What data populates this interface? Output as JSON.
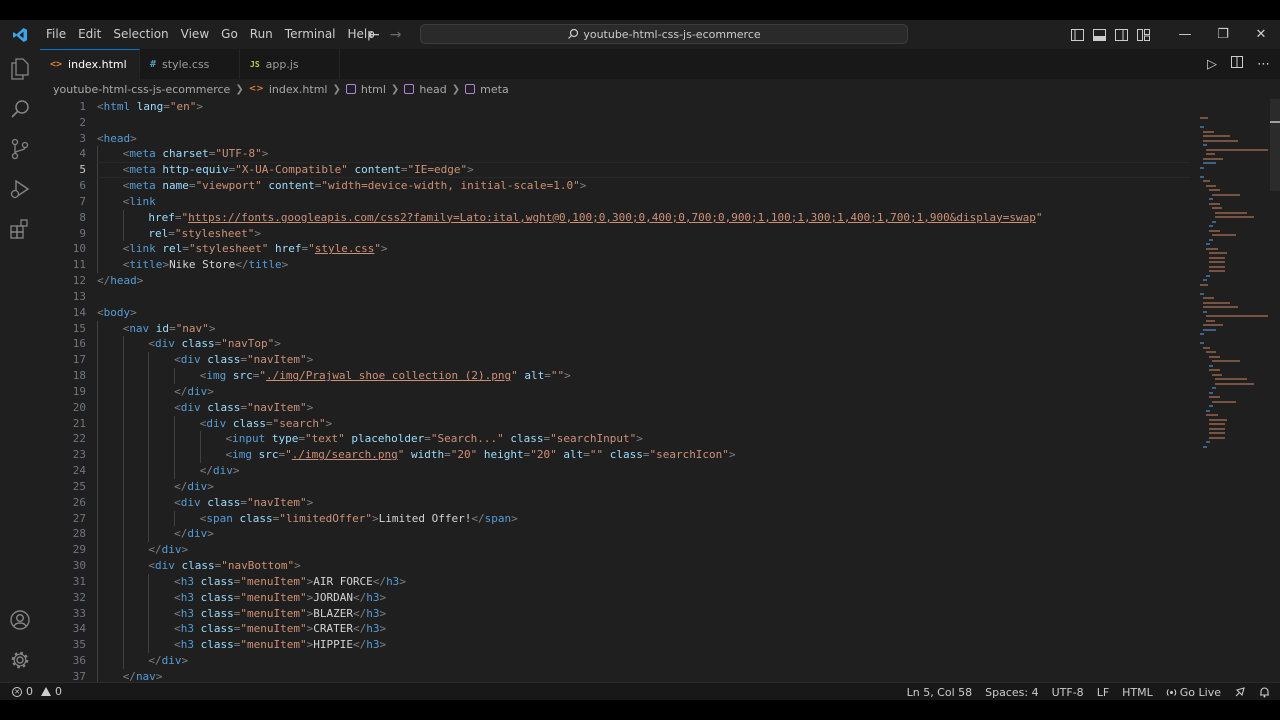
{
  "colors": {
    "accent": "#0078d4",
    "tag": "#569cd6",
    "attribute": "#9cdcfe",
    "string": "#ce9178",
    "text": "#d4d4d4",
    "punctuation": "#808080"
  },
  "titlebar": {
    "app_icon": "vscode-logo-icon",
    "menu": [
      "File",
      "Edit",
      "Selection",
      "View",
      "Go",
      "Run",
      "Terminal",
      "Help"
    ],
    "search_text": "youtube-html-css-js-ecommerce",
    "window_buttons": [
      "minimize",
      "maximize",
      "close"
    ]
  },
  "activitybar": {
    "top": [
      "explorer-icon",
      "search-icon",
      "source-control-icon",
      "run-debug-icon",
      "extensions-icon"
    ],
    "bottom": [
      "accounts-icon",
      "settings-gear-icon"
    ]
  },
  "tabs": [
    {
      "label": "index.html",
      "icon": "<>",
      "active": true
    },
    {
      "label": "style.css",
      "icon": "#",
      "active": false
    },
    {
      "label": "app.js",
      "icon": "JS",
      "active": false
    }
  ],
  "breadcrumb": [
    "youtube-html-css-js-ecommerce",
    "index.html",
    "html",
    "head",
    "meta"
  ],
  "editor": {
    "current_line": 5,
    "lines": [
      {
        "n": 1,
        "indent": 0,
        "tokens": [
          [
            "p",
            "<"
          ],
          [
            "t",
            "html"
          ],
          [
            "a",
            " lang"
          ],
          [
            "p",
            "="
          ],
          [
            "s",
            "\"en\""
          ],
          [
            "p",
            ">"
          ]
        ]
      },
      {
        "n": 2,
        "indent": 0,
        "tokens": []
      },
      {
        "n": 3,
        "indent": 0,
        "tokens": [
          [
            "p",
            "<"
          ],
          [
            "t",
            "head"
          ],
          [
            "p",
            ">"
          ]
        ]
      },
      {
        "n": 4,
        "indent": 1,
        "tokens": [
          [
            "p",
            "<"
          ],
          [
            "t",
            "meta"
          ],
          [
            "a",
            " charset"
          ],
          [
            "p",
            "="
          ],
          [
            "s",
            "\"UTF-8\""
          ],
          [
            "p",
            ">"
          ]
        ]
      },
      {
        "n": 5,
        "indent": 1,
        "tokens": [
          [
            "p",
            "<"
          ],
          [
            "t",
            "meta"
          ],
          [
            "a",
            " http-equiv"
          ],
          [
            "p",
            "="
          ],
          [
            "s",
            "\"X-UA-Compatible\""
          ],
          [
            "a",
            " content"
          ],
          [
            "p",
            "="
          ],
          [
            "s",
            "\"IE=edge\""
          ],
          [
            "p",
            ">"
          ]
        ]
      },
      {
        "n": 6,
        "indent": 1,
        "tokens": [
          [
            "p",
            "<"
          ],
          [
            "t",
            "meta"
          ],
          [
            "a",
            " name"
          ],
          [
            "p",
            "="
          ],
          [
            "s",
            "\"viewport\""
          ],
          [
            "a",
            " content"
          ],
          [
            "p",
            "="
          ],
          [
            "s",
            "\"width=device-width, initial-scale=1.0\""
          ],
          [
            "p",
            ">"
          ]
        ]
      },
      {
        "n": 7,
        "indent": 1,
        "tokens": [
          [
            "p",
            "<"
          ],
          [
            "t",
            "link"
          ]
        ]
      },
      {
        "n": 8,
        "indent": 2,
        "tokens": [
          [
            "a",
            "href"
          ],
          [
            "p",
            "="
          ],
          [
            "s",
            "\""
          ],
          [
            "u",
            "https://fonts.googleapis.com/css2?family=Lato:ital,wght@0,100;0,300;0,400;0,700;0,900;1,100;1,300;1,400;1,700;1,900&display=swap"
          ],
          [
            "s",
            "\""
          ]
        ]
      },
      {
        "n": 9,
        "indent": 2,
        "tokens": [
          [
            "a",
            "rel"
          ],
          [
            "p",
            "="
          ],
          [
            "s",
            "\"stylesheet\""
          ],
          [
            "p",
            ">"
          ]
        ]
      },
      {
        "n": 10,
        "indent": 1,
        "tokens": [
          [
            "p",
            "<"
          ],
          [
            "t",
            "link"
          ],
          [
            "a",
            " rel"
          ],
          [
            "p",
            "="
          ],
          [
            "s",
            "\"stylesheet\""
          ],
          [
            "a",
            " href"
          ],
          [
            "p",
            "="
          ],
          [
            "s",
            "\""
          ],
          [
            "u",
            "style.css"
          ],
          [
            "s",
            "\""
          ],
          [
            "p",
            ">"
          ]
        ]
      },
      {
        "n": 11,
        "indent": 1,
        "tokens": [
          [
            "p",
            "<"
          ],
          [
            "t",
            "title"
          ],
          [
            "p",
            ">"
          ],
          [
            "x",
            "Nike Store"
          ],
          [
            "p",
            "</"
          ],
          [
            "t",
            "title"
          ],
          [
            "p",
            ">"
          ]
        ]
      },
      {
        "n": 12,
        "indent": 0,
        "tokens": [
          [
            "p",
            "</"
          ],
          [
            "t",
            "head"
          ],
          [
            "p",
            ">"
          ]
        ]
      },
      {
        "n": 13,
        "indent": 0,
        "tokens": []
      },
      {
        "n": 14,
        "indent": 0,
        "tokens": [
          [
            "p",
            "<"
          ],
          [
            "t",
            "body"
          ],
          [
            "p",
            ">"
          ]
        ]
      },
      {
        "n": 15,
        "indent": 1,
        "tokens": [
          [
            "p",
            "<"
          ],
          [
            "t",
            "nav"
          ],
          [
            "a",
            " id"
          ],
          [
            "p",
            "="
          ],
          [
            "s",
            "\"nav\""
          ],
          [
            "p",
            ">"
          ]
        ]
      },
      {
        "n": 16,
        "indent": 2,
        "tokens": [
          [
            "p",
            "<"
          ],
          [
            "t",
            "div"
          ],
          [
            "a",
            " class"
          ],
          [
            "p",
            "="
          ],
          [
            "s",
            "\"navTop\""
          ],
          [
            "p",
            ">"
          ]
        ]
      },
      {
        "n": 17,
        "indent": 3,
        "tokens": [
          [
            "p",
            "<"
          ],
          [
            "t",
            "div"
          ],
          [
            "a",
            " class"
          ],
          [
            "p",
            "="
          ],
          [
            "s",
            "\"navItem\""
          ],
          [
            "p",
            ">"
          ]
        ]
      },
      {
        "n": 18,
        "indent": 4,
        "tokens": [
          [
            "p",
            "<"
          ],
          [
            "t",
            "img"
          ],
          [
            "a",
            " src"
          ],
          [
            "p",
            "="
          ],
          [
            "s",
            "\""
          ],
          [
            "u",
            "./img/Prajwal shoe collection (2).png"
          ],
          [
            "s",
            "\""
          ],
          [
            "a",
            " alt"
          ],
          [
            "p",
            "="
          ],
          [
            "s",
            "\"\""
          ],
          [
            "p",
            ">"
          ]
        ]
      },
      {
        "n": 19,
        "indent": 3,
        "tokens": [
          [
            "p",
            "</"
          ],
          [
            "t",
            "div"
          ],
          [
            "p",
            ">"
          ]
        ]
      },
      {
        "n": 20,
        "indent": 3,
        "tokens": [
          [
            "p",
            "<"
          ],
          [
            "t",
            "div"
          ],
          [
            "a",
            " class"
          ],
          [
            "p",
            "="
          ],
          [
            "s",
            "\"navItem\""
          ],
          [
            "p",
            ">"
          ]
        ]
      },
      {
        "n": 21,
        "indent": 4,
        "tokens": [
          [
            "p",
            "<"
          ],
          [
            "t",
            "div"
          ],
          [
            "a",
            " class"
          ],
          [
            "p",
            "="
          ],
          [
            "s",
            "\"search\""
          ],
          [
            "p",
            ">"
          ]
        ]
      },
      {
        "n": 22,
        "indent": 5,
        "tokens": [
          [
            "p",
            "<"
          ],
          [
            "t",
            "input"
          ],
          [
            "a",
            " type"
          ],
          [
            "p",
            "="
          ],
          [
            "s",
            "\"text\""
          ],
          [
            "a",
            " placeholder"
          ],
          [
            "p",
            "="
          ],
          [
            "s",
            "\"Search...\""
          ],
          [
            "a",
            " class"
          ],
          [
            "p",
            "="
          ],
          [
            "s",
            "\"searchInput\""
          ],
          [
            "p",
            ">"
          ]
        ]
      },
      {
        "n": 23,
        "indent": 5,
        "tokens": [
          [
            "p",
            "<"
          ],
          [
            "t",
            "img"
          ],
          [
            "a",
            " src"
          ],
          [
            "p",
            "="
          ],
          [
            "s",
            "\""
          ],
          [
            "u",
            "./img/search.png"
          ],
          [
            "s",
            "\""
          ],
          [
            "a",
            " width"
          ],
          [
            "p",
            "="
          ],
          [
            "s",
            "\"20\""
          ],
          [
            "a",
            " height"
          ],
          [
            "p",
            "="
          ],
          [
            "s",
            "\"20\""
          ],
          [
            "a",
            " alt"
          ],
          [
            "p",
            "="
          ],
          [
            "s",
            "\"\""
          ],
          [
            "a",
            " class"
          ],
          [
            "p",
            "="
          ],
          [
            "s",
            "\"searchIcon\""
          ],
          [
            "p",
            ">"
          ]
        ]
      },
      {
        "n": 24,
        "indent": 4,
        "tokens": [
          [
            "p",
            "</"
          ],
          [
            "t",
            "div"
          ],
          [
            "p",
            ">"
          ]
        ]
      },
      {
        "n": 25,
        "indent": 3,
        "tokens": [
          [
            "p",
            "</"
          ],
          [
            "t",
            "div"
          ],
          [
            "p",
            ">"
          ]
        ]
      },
      {
        "n": 26,
        "indent": 3,
        "tokens": [
          [
            "p",
            "<"
          ],
          [
            "t",
            "div"
          ],
          [
            "a",
            " class"
          ],
          [
            "p",
            "="
          ],
          [
            "s",
            "\"navItem\""
          ],
          [
            "p",
            ">"
          ]
        ]
      },
      {
        "n": 27,
        "indent": 4,
        "tokens": [
          [
            "p",
            "<"
          ],
          [
            "t",
            "span"
          ],
          [
            "a",
            " class"
          ],
          [
            "p",
            "="
          ],
          [
            "s",
            "\"limitedOffer\""
          ],
          [
            "p",
            ">"
          ],
          [
            "x",
            "Limited Offer!"
          ],
          [
            "p",
            "</"
          ],
          [
            "t",
            "span"
          ],
          [
            "p",
            ">"
          ]
        ]
      },
      {
        "n": 28,
        "indent": 3,
        "tokens": [
          [
            "p",
            "</"
          ],
          [
            "t",
            "div"
          ],
          [
            "p",
            ">"
          ]
        ]
      },
      {
        "n": 29,
        "indent": 2,
        "tokens": [
          [
            "p",
            "</"
          ],
          [
            "t",
            "div"
          ],
          [
            "p",
            ">"
          ]
        ]
      },
      {
        "n": 30,
        "indent": 2,
        "tokens": [
          [
            "p",
            "<"
          ],
          [
            "t",
            "div"
          ],
          [
            "a",
            " class"
          ],
          [
            "p",
            "="
          ],
          [
            "s",
            "\"navBottom\""
          ],
          [
            "p",
            ">"
          ]
        ]
      },
      {
        "n": 31,
        "indent": 3,
        "tokens": [
          [
            "p",
            "<"
          ],
          [
            "t",
            "h3"
          ],
          [
            "a",
            " class"
          ],
          [
            "p",
            "="
          ],
          [
            "s",
            "\"menuItem\""
          ],
          [
            "p",
            ">"
          ],
          [
            "x",
            "AIR FORCE"
          ],
          [
            "p",
            "</"
          ],
          [
            "t",
            "h3"
          ],
          [
            "p",
            ">"
          ]
        ]
      },
      {
        "n": 32,
        "indent": 3,
        "tokens": [
          [
            "p",
            "<"
          ],
          [
            "t",
            "h3"
          ],
          [
            "a",
            " class"
          ],
          [
            "p",
            "="
          ],
          [
            "s",
            "\"menuItem\""
          ],
          [
            "p",
            ">"
          ],
          [
            "x",
            "JORDAN"
          ],
          [
            "p",
            "</"
          ],
          [
            "t",
            "h3"
          ],
          [
            "p",
            ">"
          ]
        ]
      },
      {
        "n": 33,
        "indent": 3,
        "tokens": [
          [
            "p",
            "<"
          ],
          [
            "t",
            "h3"
          ],
          [
            "a",
            " class"
          ],
          [
            "p",
            "="
          ],
          [
            "s",
            "\"menuItem\""
          ],
          [
            "p",
            ">"
          ],
          [
            "x",
            "BLAZER"
          ],
          [
            "p",
            "</"
          ],
          [
            "t",
            "h3"
          ],
          [
            "p",
            ">"
          ]
        ]
      },
      {
        "n": 34,
        "indent": 3,
        "tokens": [
          [
            "p",
            "<"
          ],
          [
            "t",
            "h3"
          ],
          [
            "a",
            " class"
          ],
          [
            "p",
            "="
          ],
          [
            "s",
            "\"menuItem\""
          ],
          [
            "p",
            ">"
          ],
          [
            "x",
            "CRATER"
          ],
          [
            "p",
            "</"
          ],
          [
            "t",
            "h3"
          ],
          [
            "p",
            ">"
          ]
        ]
      },
      {
        "n": 35,
        "indent": 3,
        "tokens": [
          [
            "p",
            "<"
          ],
          [
            "t",
            "h3"
          ],
          [
            "a",
            " class"
          ],
          [
            "p",
            "="
          ],
          [
            "s",
            "\"menuItem\""
          ],
          [
            "p",
            ">"
          ],
          [
            "x",
            "HIPPIE"
          ],
          [
            "p",
            "</"
          ],
          [
            "t",
            "h3"
          ],
          [
            "p",
            ">"
          ]
        ]
      },
      {
        "n": 36,
        "indent": 2,
        "tokens": [
          [
            "p",
            "</"
          ],
          [
            "t",
            "div"
          ],
          [
            "p",
            ">"
          ]
        ]
      },
      {
        "n": 37,
        "indent": 1,
        "tokens": [
          [
            "p",
            "</"
          ],
          [
            "t",
            "nav"
          ],
          [
            "p",
            ">"
          ]
        ]
      }
    ]
  },
  "statusbar": {
    "errors": "0",
    "warnings": "0",
    "position": "Ln 5, Col 58",
    "spaces": "Spaces: 4",
    "encoding": "UTF-8",
    "eol": "LF",
    "language": "HTML",
    "go_live": "Go Live"
  }
}
